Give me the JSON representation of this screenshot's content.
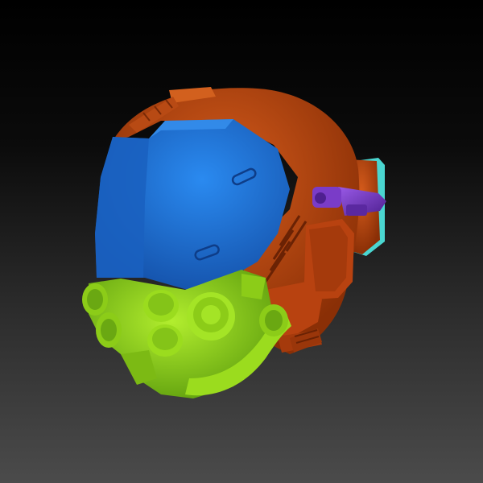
{
  "scene": {
    "subject": "sculpted-helmet-polygroups",
    "colors": {
      "background_top": "#000000",
      "background_bottom": "#4b4b4b",
      "visor": "#1f78d8",
      "visor_dark": "#1450a8",
      "shell": "#c24a10",
      "shell_dark": "#8a2f06",
      "mask": "#9bdc1e",
      "mask_dark": "#5a9a0c",
      "clip": "#7a3cc8",
      "clip_dark": "#4e2090",
      "accent": "#4ad6d0"
    }
  }
}
